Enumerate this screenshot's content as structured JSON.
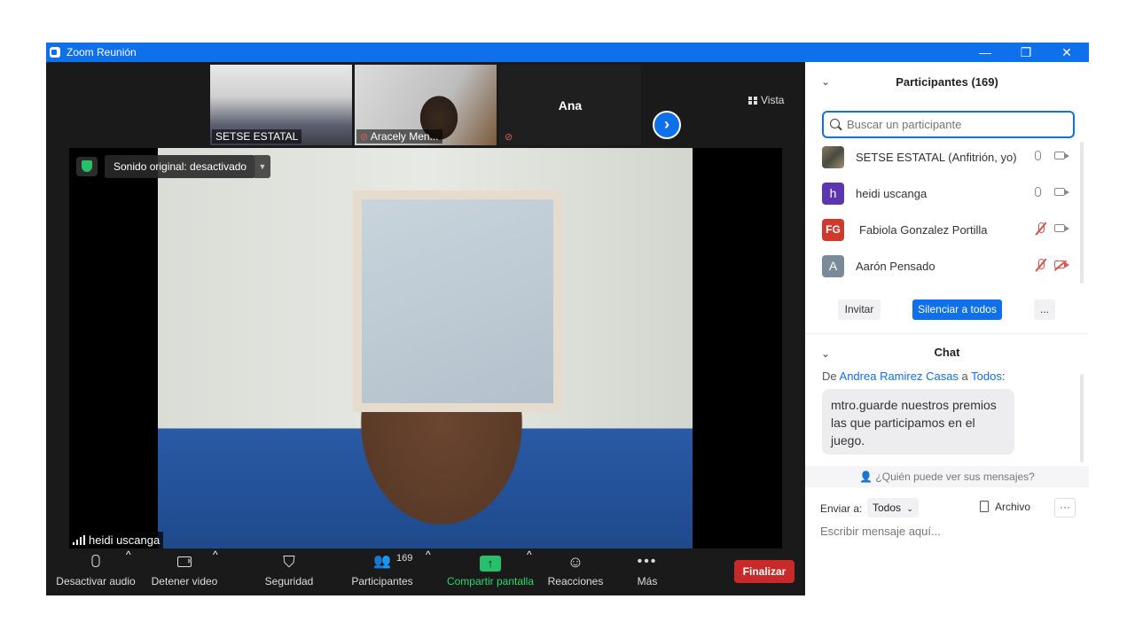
{
  "window": {
    "title": "Zoom Reunión",
    "minimize": "—",
    "restore": "❐",
    "close": "✕"
  },
  "thumbnails": [
    {
      "label": "SETSE ESTATAL"
    },
    {
      "label": "Aracely Men..."
    },
    {
      "label": "Ana"
    }
  ],
  "view_button": "Vista",
  "main_video": {
    "sound_option": "Sonido original: desactivado",
    "speaker": "heidi uscanga"
  },
  "toolbar": {
    "audio": "Desactivar audio",
    "video": "Detener video",
    "security": "Seguridad",
    "participants": "Participantes",
    "participants_count": "169",
    "share": "Compartir pantalla",
    "reactions": "Reacciones",
    "more": "Más",
    "end": "Finalizar"
  },
  "participants_panel": {
    "title": "Participantes (169)",
    "search_placeholder": "Buscar un participante",
    "list": [
      {
        "name": "SETSE ESTATAL (Anfitrión, yo)",
        "initials": "",
        "color": "#6b6a5e"
      },
      {
        "name": "heidi uscanga",
        "initials": "h",
        "color": "#5e35b1"
      },
      {
        "name": "Fabiola Gonzalez Portilla",
        "initials": "FG",
        "color": "#d0392b"
      },
      {
        "name": "Aarón Pensado",
        "initials": "A",
        "color": "#7a8a99"
      }
    ],
    "invite": "Invitar",
    "mute_all": "Silenciar a todos",
    "more": "..."
  },
  "chat": {
    "title": "Chat",
    "from_prefix": "De",
    "from_name": "Andrea Ramirez Casas",
    "to_word": "a",
    "to_target": "Todos",
    "message": "mtro.guarde nuestros premios las que participamos en el juego.",
    "who_sees": "¿Quién puede ver sus mensajes?",
    "send_to_label": "Enviar a:",
    "send_to_value": "Todos",
    "file": "Archivo",
    "input_placeholder": "Escribir mensaje aquí..."
  }
}
